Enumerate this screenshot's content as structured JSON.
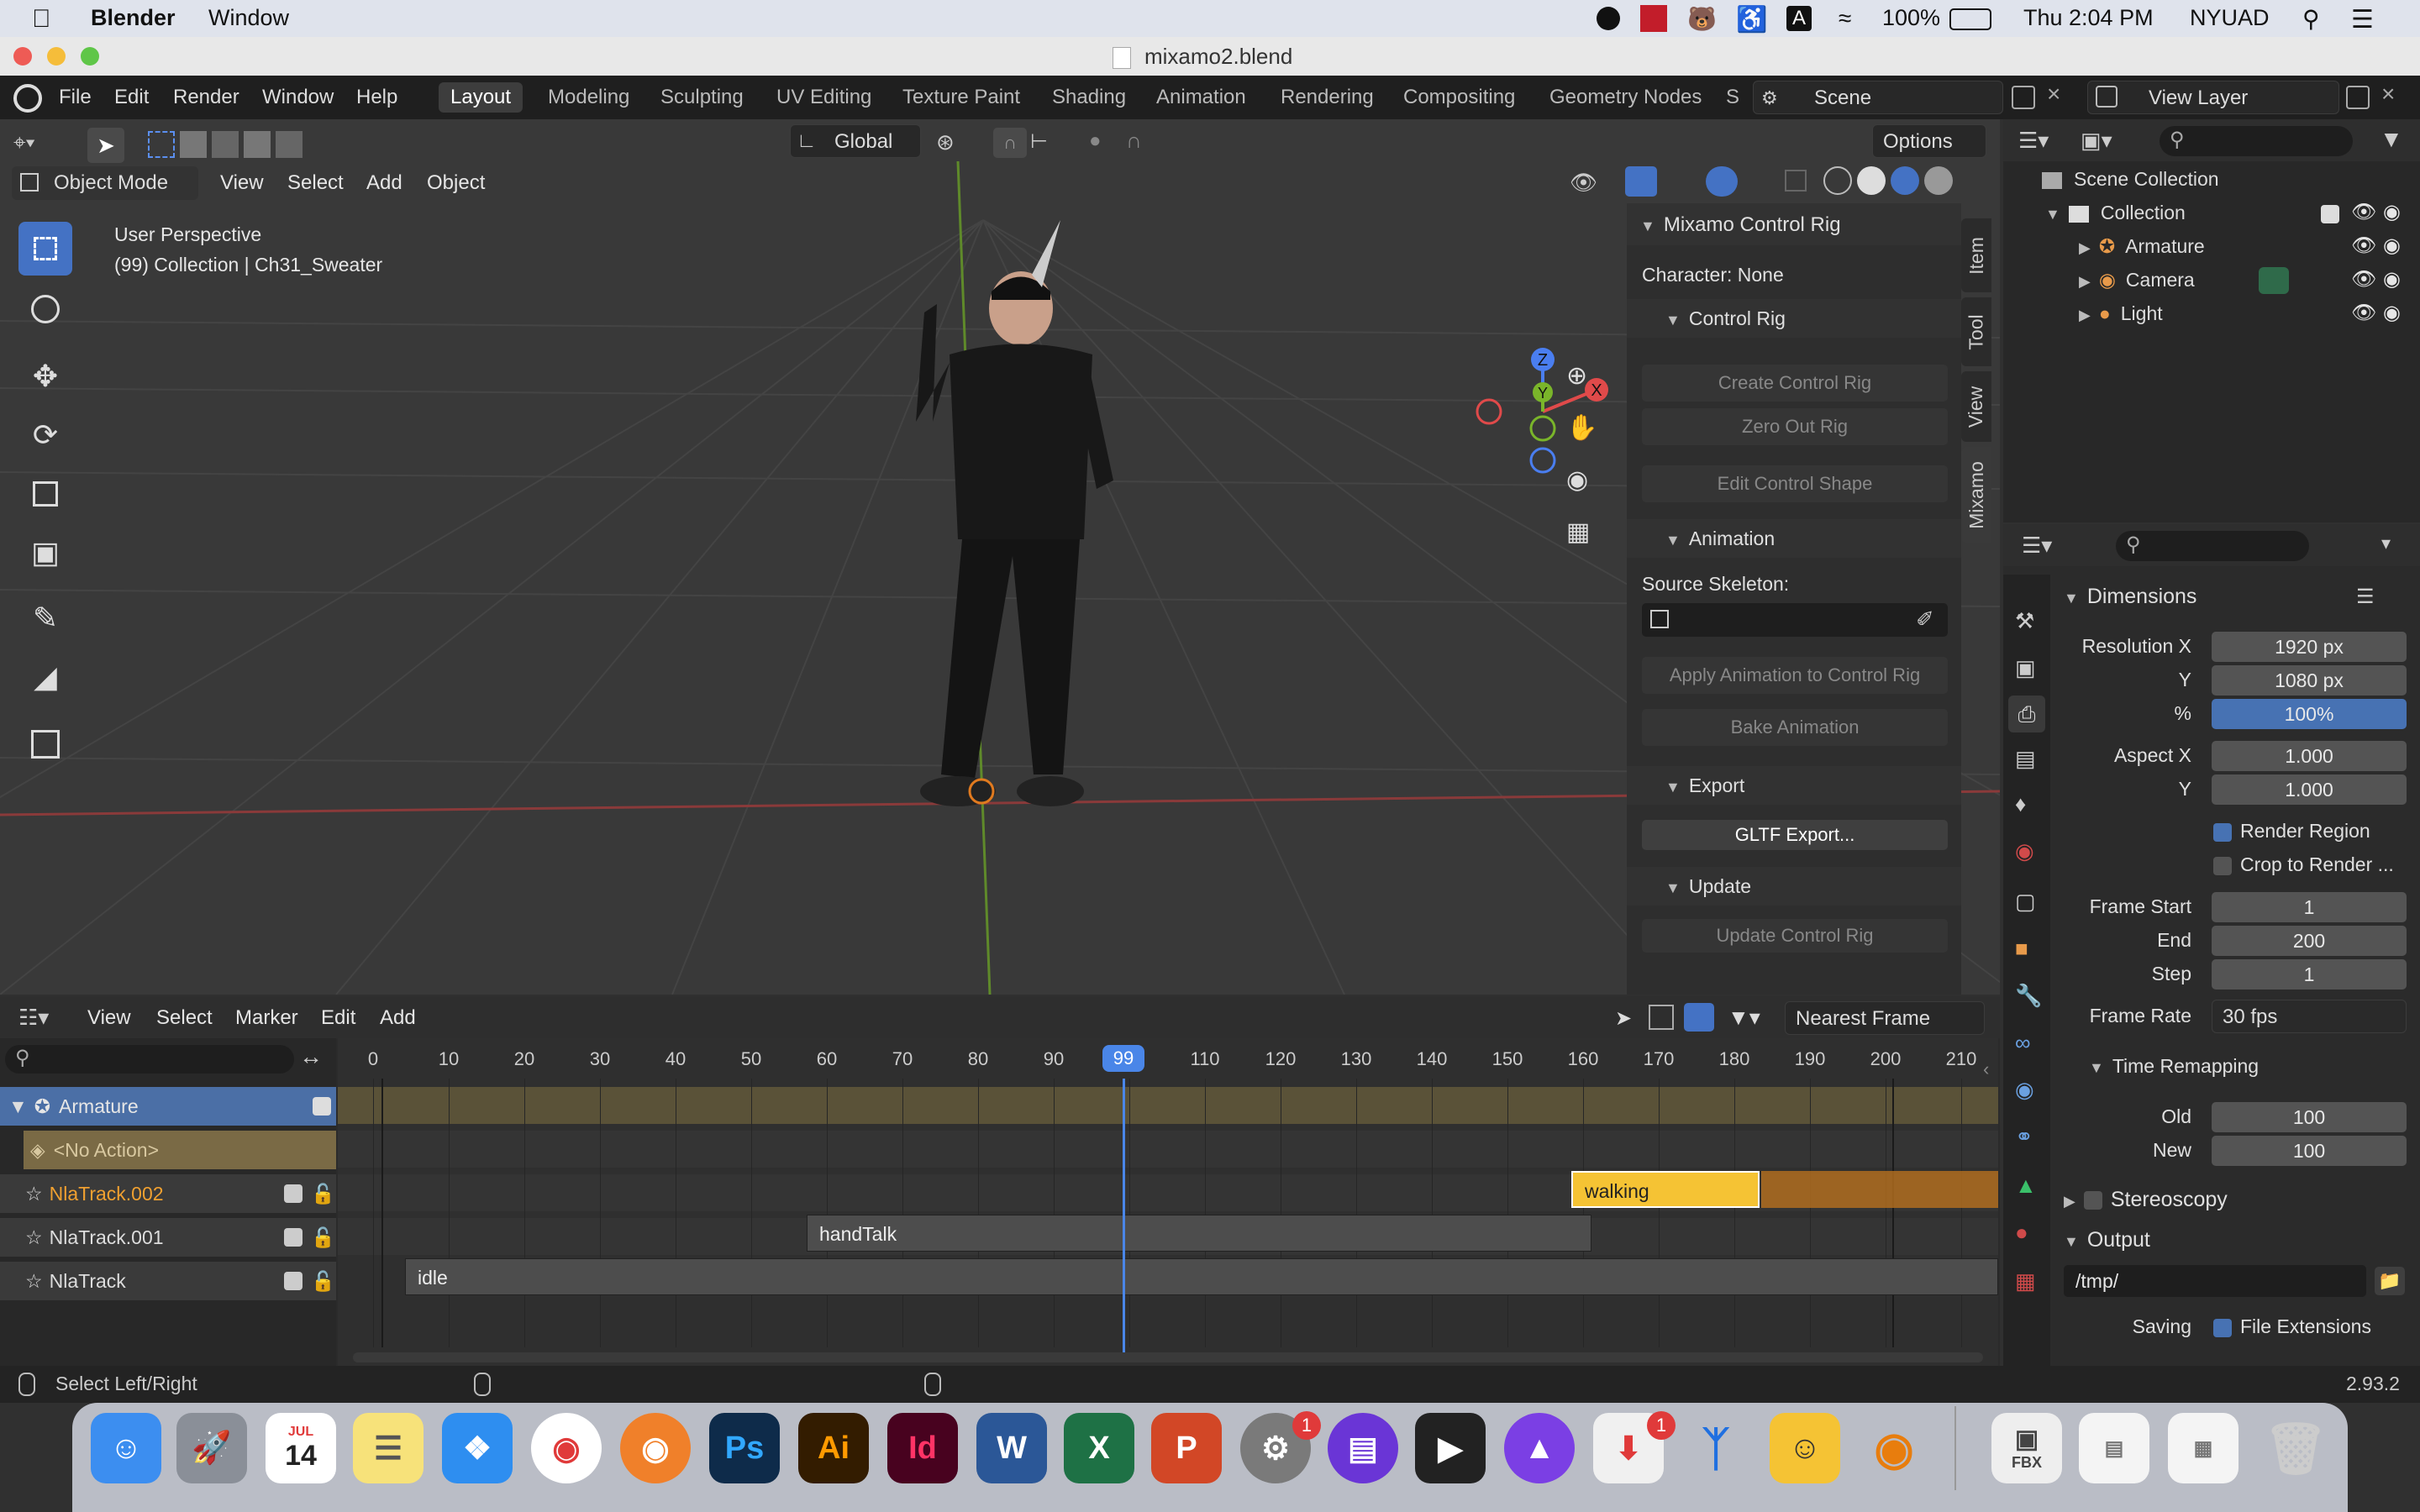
{
  "menubar": {
    "apple": "",
    "app": "Blender",
    "window": "Window",
    "battery": "100%",
    "clock": "Thu 2:04 PM",
    "user": "NYUAD"
  },
  "window_title": "mixamo2.blend",
  "blender_menu": [
    "File",
    "Edit",
    "Render",
    "Window",
    "Help"
  ],
  "workspaces": [
    "Layout",
    "Modeling",
    "Sculpting",
    "UV Editing",
    "Texture Paint",
    "Shading",
    "Animation",
    "Rendering",
    "Compositing",
    "Geometry Nodes",
    "S"
  ],
  "scene": "Scene",
  "view_layer": "View Layer",
  "viewport": {
    "mode": "Object Mode",
    "menus": [
      "View",
      "Select",
      "Add",
      "Object"
    ],
    "orientation": "Global",
    "options": "Options",
    "overlay_line1": "User Perspective",
    "overlay_line2": "(99) Collection | Ch31_Sweater",
    "gizmo": {
      "z": "Z",
      "y": "Y",
      "x": "X"
    }
  },
  "sidebar_tabs": [
    "Item",
    "Tool",
    "View",
    "Mixamo"
  ],
  "mixamo": {
    "title": "Mixamo Control Rig",
    "character": "Character: None",
    "control_rig": "Control Rig",
    "create": "Create Control Rig",
    "zero_out": "Zero Out Rig",
    "edit_shape": "Edit Control Shape",
    "animation": "Animation",
    "source_skeleton": "Source Skeleton:",
    "apply": "Apply Animation to Control Rig",
    "bake": "Bake Animation",
    "export": "Export",
    "gltf": "GLTF Export...",
    "update": "Update",
    "update_rig": "Update Control Rig"
  },
  "outliner": {
    "root": "Scene Collection",
    "collection": "Collection",
    "items": [
      "Armature",
      "Camera",
      "Light"
    ]
  },
  "properties": {
    "dimensions": "Dimensions",
    "res_x_label": "Resolution X",
    "res_x": "1920 px",
    "res_y_label": "Y",
    "res_y": "1080 px",
    "pct_label": "%",
    "pct": "100%",
    "aspect_x_label": "Aspect X",
    "aspect_x": "1.000",
    "aspect_y_label": "Y",
    "aspect_y": "1.000",
    "render_region": "Render Region",
    "crop": "Crop to Render ...",
    "frame_start_label": "Frame Start",
    "frame_start": "1",
    "end_label": "End",
    "end": "200",
    "step_label": "Step",
    "step": "1",
    "frame_rate_label": "Frame Rate",
    "frame_rate": "30 fps",
    "time_remap": "Time Remapping",
    "old_label": "Old",
    "old": "100",
    "new_label": "New",
    "new": "100",
    "stereoscopy": "Stereoscopy",
    "output": "Output",
    "path": "/tmp/",
    "saving": "Saving",
    "file_ext": "File Extensions"
  },
  "nla": {
    "menus": [
      "View",
      "Select",
      "Marker",
      "Edit",
      "Add"
    ],
    "snap": "Nearest Frame",
    "ticks": [
      "0",
      "10",
      "20",
      "30",
      "40",
      "50",
      "60",
      "70",
      "80",
      "90",
      "99",
      "110",
      "120",
      "130",
      "140",
      "150",
      "160",
      "170",
      "180",
      "190",
      "200",
      "210"
    ],
    "current_frame": 99,
    "tracks": {
      "armature": "Armature",
      "no_action": "<No Action>",
      "t2": "NlaTrack.002",
      "t1": "NlaTrack.001",
      "t0": "NlaTrack"
    },
    "strips": {
      "walking": "walking",
      "handtalk": "handTalk",
      "idle": "idle"
    }
  },
  "status": {
    "left": "Select Left/Right",
    "version": "2.93.2"
  },
  "dock": {
    "calendar_month": "JUL",
    "calendar_day": "14",
    "badge1": "1",
    "badge2": "1",
    "fbx": "FBX"
  }
}
